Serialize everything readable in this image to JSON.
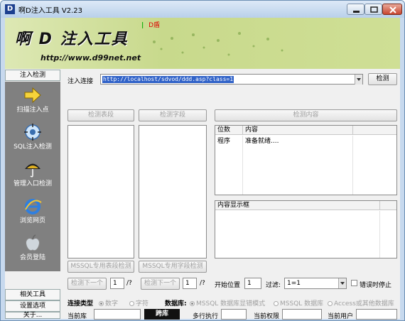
{
  "window": {
    "app_icon": "D",
    "title": "啊D注入工具 V2.23",
    "controls": [
      "minimize-icon",
      "restore-icon",
      "close-icon"
    ]
  },
  "banner": {
    "logo": "啊 D 注入工具",
    "url": "http://www.d99net.net",
    "indicator": "|",
    "mark": "D盾"
  },
  "sidebar": {
    "top_tab": "注入检测",
    "items": [
      {
        "label": "扫描注入点",
        "icon": "arrow-right-icon"
      },
      {
        "label": "SQL注入检测",
        "icon": "target-icon"
      },
      {
        "label": "管理入口检测",
        "icon": "umbrella-icon"
      },
      {
        "label": "浏览网页",
        "icon": "ie-icon"
      },
      {
        "label": "会员登陆",
        "icon": "apple-icon"
      }
    ],
    "bottom_tabs": [
      "相关工具",
      "设置选项",
      "关于..."
    ]
  },
  "inject": {
    "label": "注入连接",
    "url_value": "http://localhost/sdvod/ddd.asp?class=1",
    "detect_button": "检测"
  },
  "buttons": {
    "detect_tables": "检测表段",
    "detect_fields": "检测字段",
    "detect_content": "检测内容",
    "mssql_tables": "MSSQL专用表段检测",
    "mssql_fields": "MSSQL专用字段检测",
    "next1": "检测下一个",
    "next2": "检测下一个"
  },
  "result_table": {
    "headers": [
      "位数",
      "内容"
    ],
    "rows": [
      [
        "程序",
        "准备就绪...."
      ]
    ]
  },
  "content_box": {
    "header": "内容显示框"
  },
  "controls_row": {
    "spin1": "1",
    "spin1_suffix": "/?",
    "spin2": "1",
    "spin2_suffix": "/?",
    "start_label": "开始位置",
    "start_value": "1",
    "filter_label": "过滤:",
    "filter_value": "1=1",
    "stop_on_error": "错误时停止"
  },
  "conn_type": {
    "label": "连接类型",
    "options": [
      "数字",
      "字符"
    ],
    "db_label": "数据库:",
    "db_options": [
      "MSSQL 数据库显错模式",
      "MSSQL 数据库",
      "Access或其他数据库"
    ]
  },
  "status": {
    "current_db_label": "当前库",
    "current_db_value": "",
    "cross_db": "跨库",
    "multi_exec_label": "多行执行",
    "multi_exec_value": "",
    "perm_label": "当前权限",
    "perm_value": "",
    "user_label": "当前用户",
    "user_value": ""
  }
}
